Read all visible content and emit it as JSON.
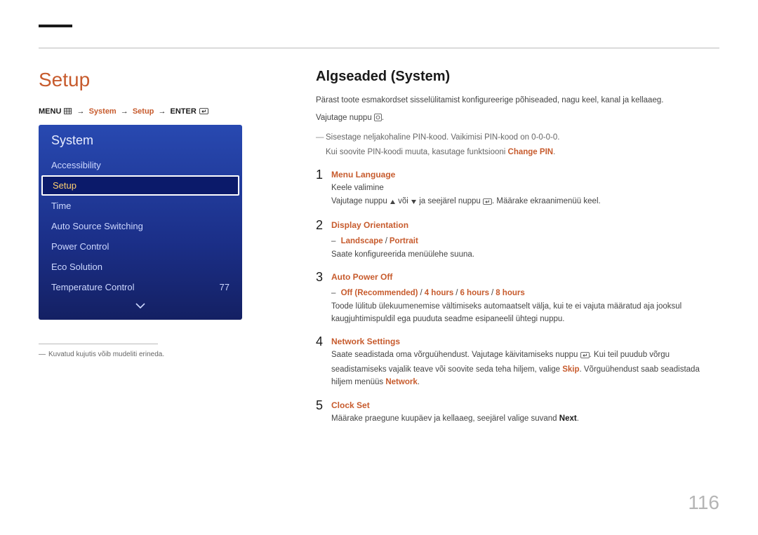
{
  "page": {
    "title": "Setup",
    "number": "116"
  },
  "breadcrumb": {
    "prefix": "MENU",
    "p1": "System",
    "p2": "Setup",
    "suffix": "ENTER"
  },
  "osd": {
    "header": "System",
    "items": [
      {
        "label": "Accessibility",
        "value": "",
        "selected": false
      },
      {
        "label": "Setup",
        "value": "",
        "selected": true
      },
      {
        "label": "Time",
        "value": "",
        "selected": false
      },
      {
        "label": "Auto Source Switching",
        "value": "",
        "selected": false
      },
      {
        "label": "Power Control",
        "value": "",
        "selected": false
      },
      {
        "label": "Eco Solution",
        "value": "",
        "selected": false
      },
      {
        "label": "Temperature Control",
        "value": "77",
        "selected": false
      }
    ]
  },
  "footnote": "Kuvatud kujutis võib mudeliti erineda.",
  "section": {
    "heading": "Algseaded (System)",
    "intro": "Pärast toote esmakordset sisselülitamist konfigureerige põhiseaded, nagu keel, kanal ja kellaaeg.",
    "press_prefix": "Vajutage nuppu ",
    "press_suffix": ".",
    "note1": "Sisestage neljakohaline PIN-kood. Vaikimisi PIN-kood on 0-0-0-0.",
    "note2_a": "Kui soovite PIN-koodi muuta, kasutage funktsiooni ",
    "note2_b": "Change PIN",
    "note2_c": "."
  },
  "steps": [
    {
      "num": "1",
      "title": "Menu Language",
      "line1": "Keele valimine",
      "line2_a": "Vajutage nuppu ",
      "line2_b": " või ",
      "line2_c": " ja seejärel nuppu ",
      "line2_d": ". Määrake ekraanimenüü keel."
    },
    {
      "num": "2",
      "title": "Display Orientation",
      "opts": [
        "Landscape",
        "Portrait"
      ],
      "line1": "Saate konfigureerida menüülehe suuna."
    },
    {
      "num": "3",
      "title": "Auto Power Off",
      "opts": [
        "Off (Recommended)",
        "4 hours",
        "6 hours",
        "8 hours"
      ],
      "line1": "Toode lülitub ülekuumenemise vältimiseks automaatselt välja, kui te ei vajuta määratud aja jooksul kaugjuhtimispuldil ega puuduta seadme esipaneelil ühtegi nuppu."
    },
    {
      "num": "4",
      "title": "Network Settings",
      "line1_a": "Saate seadistada oma võrguühendust. Vajutage käivitamiseks nuppu ",
      "line1_b": ". Kui teil puudub võrgu seadistamiseks vajalik teave või soovite seda teha hiljem, valige ",
      "skip": "Skip",
      "line1_c": ". Võrguühendust saab seadistada hiljem menüüs ",
      "network": "Network",
      "line1_d": "."
    },
    {
      "num": "5",
      "title": "Clock Set",
      "line1_a": "Määrake praegune kuupäev ja kellaaeg, seejärel valige suvand ",
      "next": "Next",
      "line1_b": "."
    }
  ]
}
